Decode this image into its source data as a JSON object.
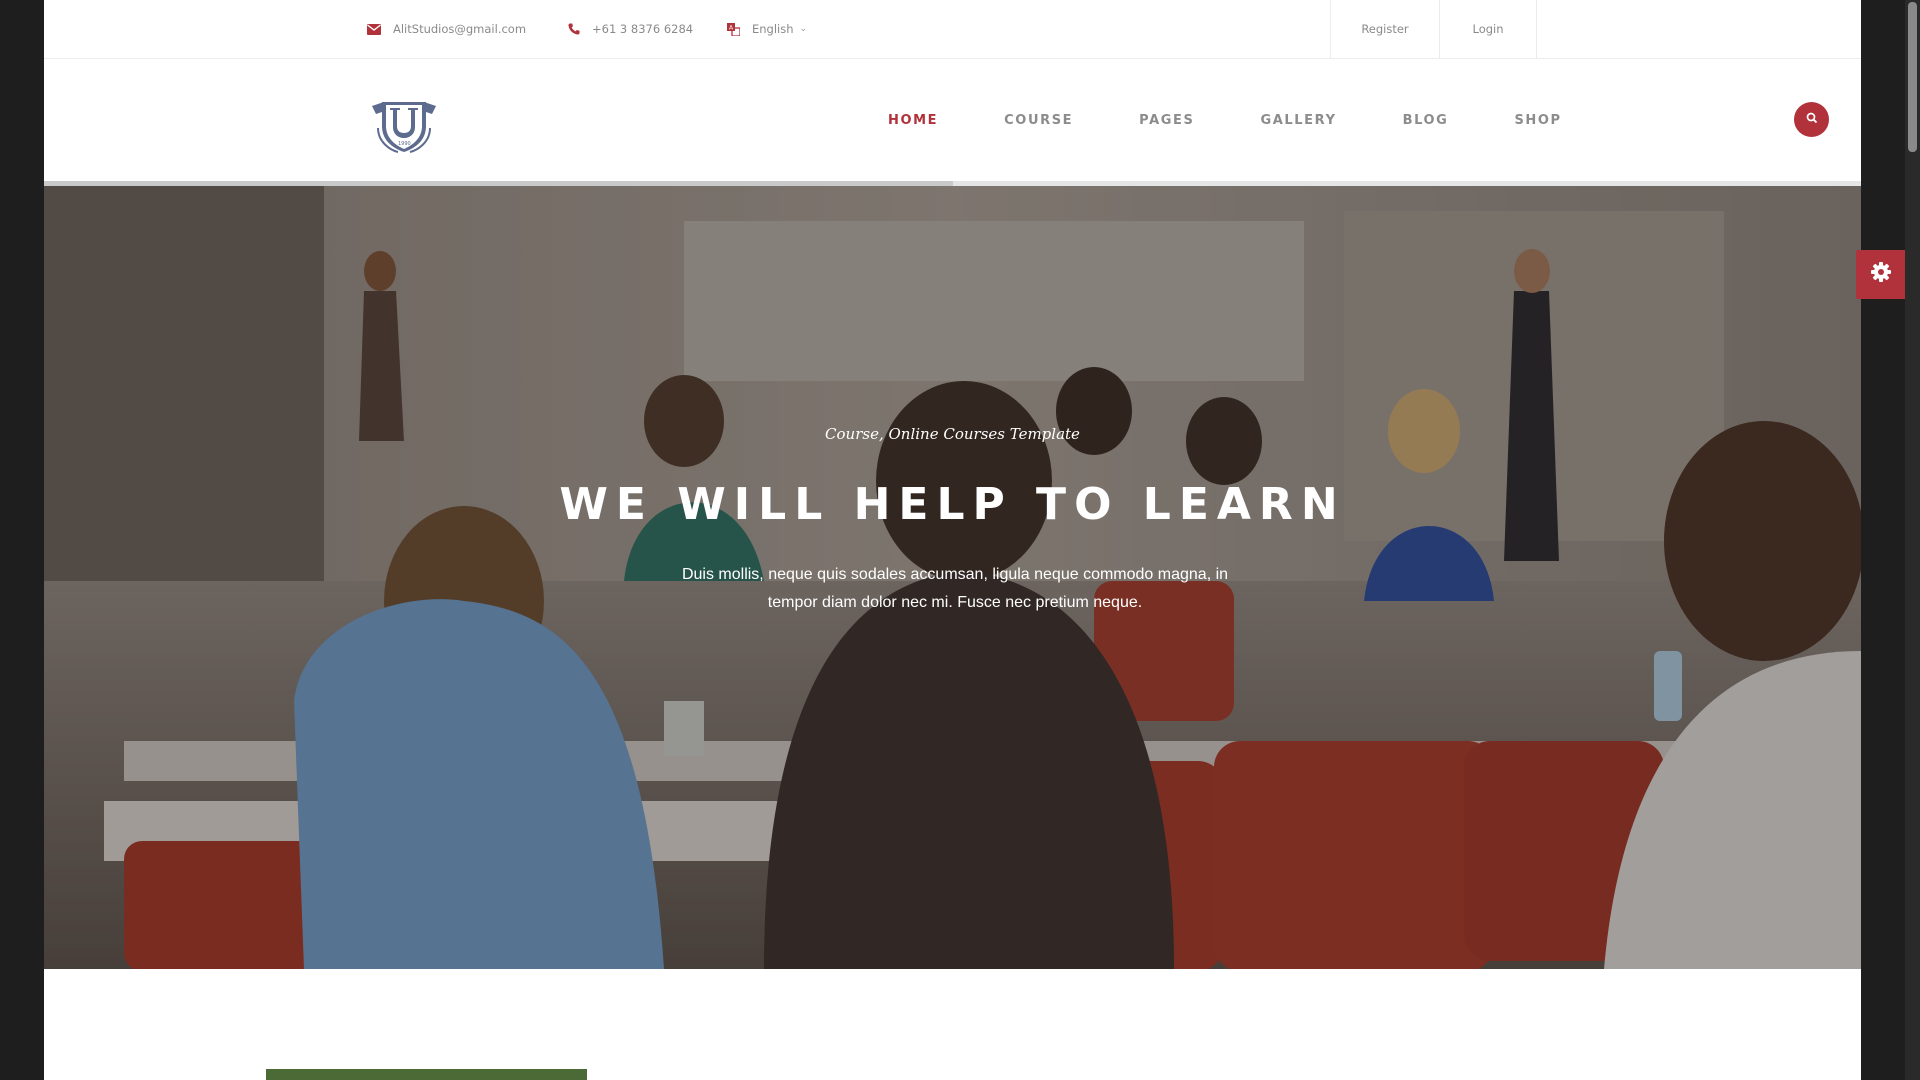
{
  "topbar": {
    "email": "AlitStudios@gmail.com",
    "phone": "+61 3 8376 6284",
    "language": "English",
    "register": "Register",
    "login": "Login"
  },
  "header": {
    "logo_icon": "university-shield-logo",
    "nav": [
      {
        "label": "HOME",
        "active": true
      },
      {
        "label": "COURSE",
        "active": false
      },
      {
        "label": "PAGES",
        "active": false
      },
      {
        "label": "GALLERY",
        "active": false
      },
      {
        "label": "BLOG",
        "active": false
      },
      {
        "label": "SHOP",
        "active": false
      }
    ],
    "search_icon": "search-icon"
  },
  "slider": {
    "progress": 0.5
  },
  "hero": {
    "subtitle": "Course, Online Courses Template",
    "title": "WE WILL HELP TO LEARN",
    "text": "Duis mollis, neque quis sodales accumsan, ligula neque commodo magna, in tempor diam dolor nec mi. Fusce nec pretium neque."
  },
  "settings_icon": "gear-icon",
  "colors": {
    "accent": "#b1323a",
    "nav_text": "#8c8c8c",
    "topbar_text": "#8a8a8a"
  }
}
